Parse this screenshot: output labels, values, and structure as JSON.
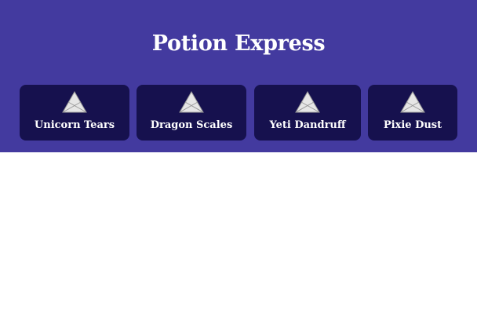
{
  "header": {
    "title": "Potion Express"
  },
  "products": [
    {
      "label": "Unicorn Tears",
      "icon": "broken-image-icon"
    },
    {
      "label": "Dragon Scales",
      "icon": "broken-image-icon"
    },
    {
      "label": "Yeti Dandruff",
      "icon": "broken-image-icon"
    },
    {
      "label": "Pixie Dust",
      "icon": "broken-image-icon"
    }
  ],
  "colors": {
    "header_background": "#433a9f",
    "card_background": "#16114e",
    "text": "#ffffff",
    "page_background": "#ffffff"
  }
}
